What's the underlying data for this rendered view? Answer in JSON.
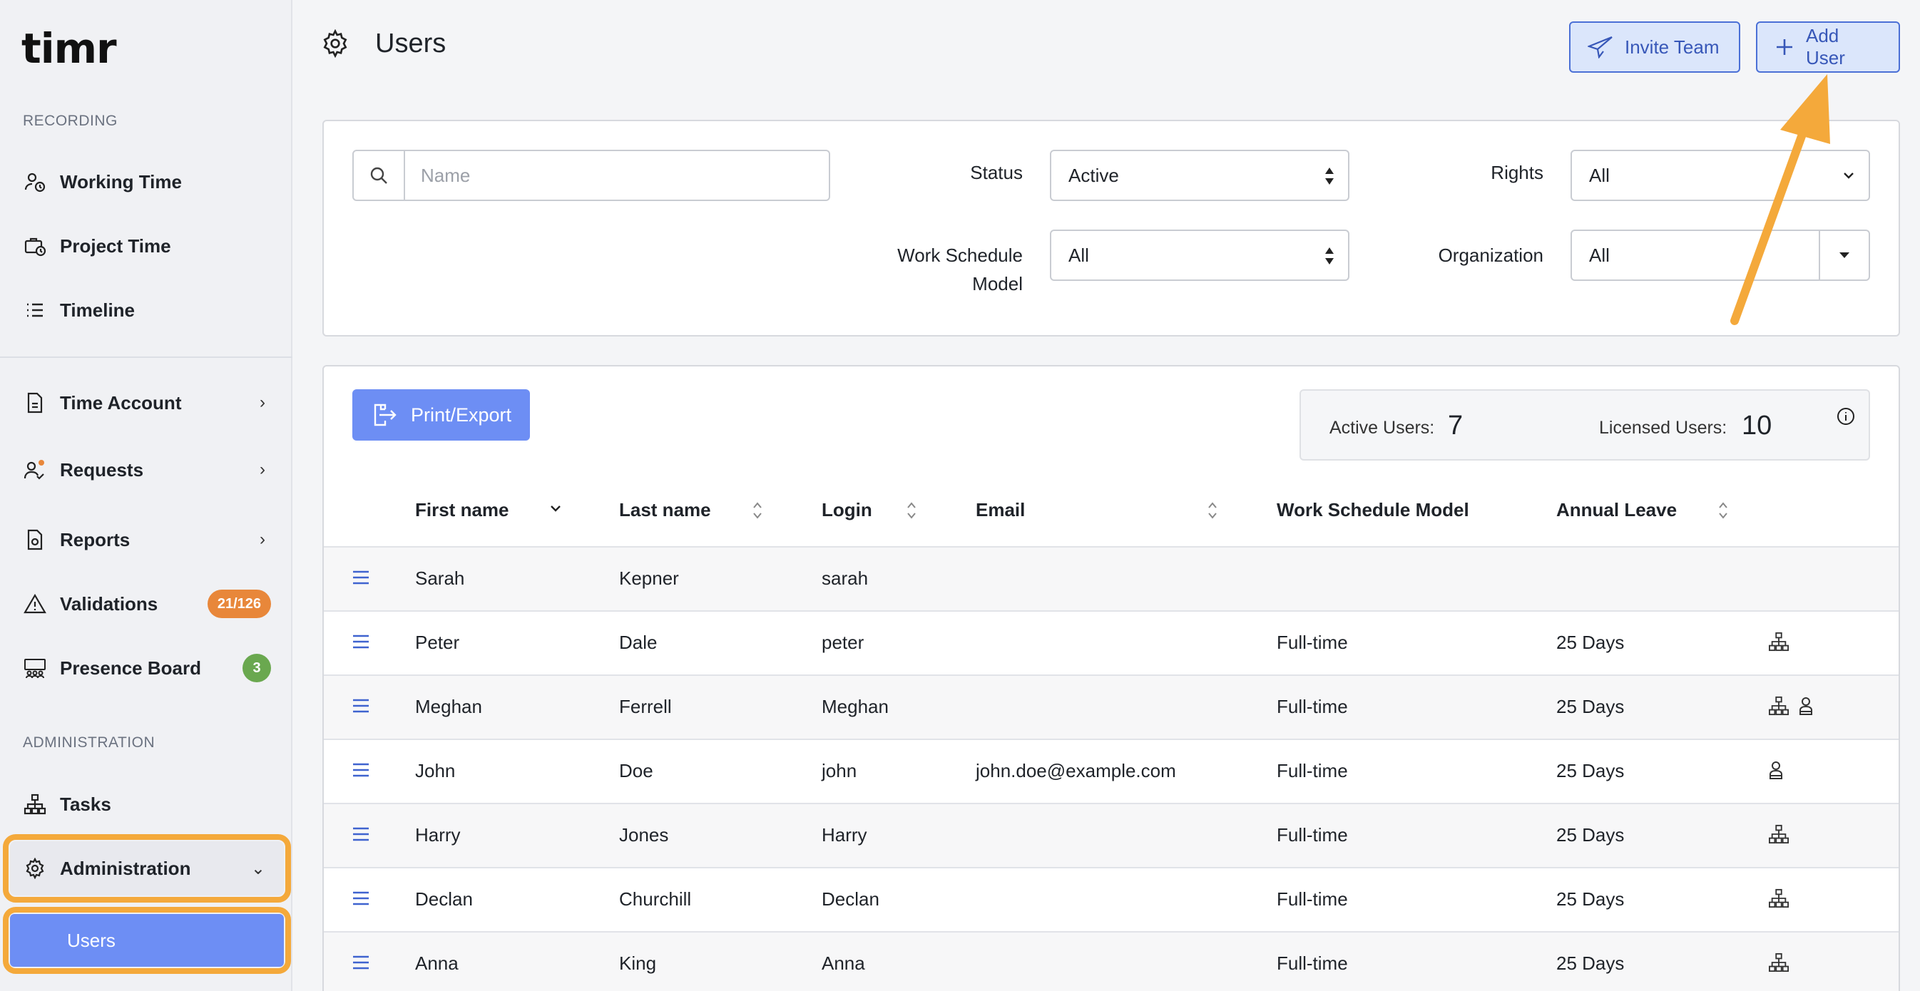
{
  "app": {
    "logo": "timr"
  },
  "sidebar": {
    "recording_label": "RECORDING",
    "administration_label": "ADMINISTRATION",
    "items": [
      {
        "label": "Working Time",
        "icon": "user-clock-icon"
      },
      {
        "label": "Project Time",
        "icon": "briefcase-clock-icon"
      },
      {
        "label": "Timeline",
        "icon": "list-icon"
      },
      {
        "label": "Time Account",
        "icon": "document-icon"
      },
      {
        "label": "Requests",
        "icon": "user-check-icon"
      },
      {
        "label": "Reports",
        "icon": "report-icon"
      },
      {
        "label": "Validations",
        "icon": "warning-icon",
        "badge": "21/126"
      },
      {
        "label": "Presence Board",
        "icon": "people-board-icon",
        "badge": "3"
      },
      {
        "label": "Tasks",
        "icon": "hierarchy-icon"
      },
      {
        "label": "Administration",
        "icon": "gear-icon"
      },
      {
        "label": "Users"
      }
    ]
  },
  "header": {
    "title": "Users",
    "invite_label": "Invite Team",
    "add_label": "Add User"
  },
  "filters": {
    "search_placeholder": "Name",
    "status_label": "Status",
    "status_value": "Active",
    "rights_label": "Rights",
    "rights_value": "All",
    "wsm_label_line1": "Work Schedule",
    "wsm_label_line2": "Model",
    "wsm_value": "All",
    "org_label": "Organization",
    "org_value": "All"
  },
  "toolbar": {
    "export_label": "Print/Export"
  },
  "stats": {
    "active_label": "Active Users:",
    "active_value": "7",
    "licensed_label": "Licensed Users:",
    "licensed_value": "10"
  },
  "table": {
    "columns": [
      "First name",
      "Last name",
      "Login",
      "Email",
      "Work Schedule Model",
      "Annual Leave"
    ],
    "rows": [
      {
        "first": "Sarah",
        "last": "Kepner",
        "login": "sarah",
        "email": "",
        "wsm": "",
        "leave": ""
      },
      {
        "first": "Peter",
        "last": "Dale",
        "login": "peter",
        "email": "",
        "wsm": "Full-time",
        "leave": "25 Days"
      },
      {
        "first": "Meghan",
        "last": "Ferrell",
        "login": "Meghan",
        "email": "",
        "wsm": "Full-time",
        "leave": "25 Days"
      },
      {
        "first": "John",
        "last": "Doe",
        "login": "john",
        "email": "john.doe@example.com",
        "wsm": "Full-time",
        "leave": "25 Days"
      },
      {
        "first": "Harry",
        "last": "Jones",
        "login": "Harry",
        "email": "",
        "wsm": "Full-time",
        "leave": "25 Days"
      },
      {
        "first": "Declan",
        "last": "Churchill",
        "login": "Declan",
        "email": "",
        "wsm": "Full-time",
        "leave": "25 Days"
      },
      {
        "first": "Anna",
        "last": "King",
        "login": "Anna",
        "email": "",
        "wsm": "Full-time",
        "leave": "25 Days"
      }
    ]
  },
  "colors": {
    "accent": "#6d8ef4",
    "highlight": "#f4a93b",
    "badge_orange": "#e8873a",
    "badge_green": "#6aa84f"
  }
}
